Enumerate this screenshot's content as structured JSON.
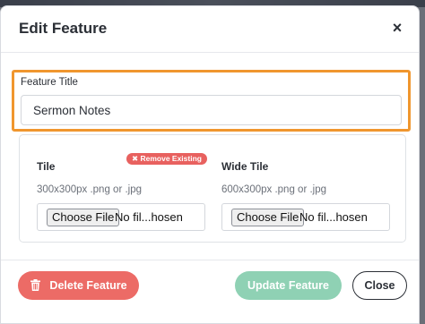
{
  "modal": {
    "title": "Edit Feature",
    "close_icon": "close-icon",
    "close_glyph": "×"
  },
  "feature_title": {
    "label": "Feature Title",
    "value": "Sermon Notes"
  },
  "tile": {
    "label": "Tile",
    "hint": "300x300px .png or .jpg",
    "remove_label": "✖ Remove Existing",
    "choose_label": "Choose File",
    "file_name": "No fil...hosen"
  },
  "wide_tile": {
    "label": "Wide Tile",
    "hint": "600x300px .png or .jpg",
    "choose_label": "Choose File",
    "file_name": "No fil...hosen"
  },
  "footer": {
    "delete_label": "Delete Feature",
    "update_label": "Update Feature",
    "close_label": "Close"
  },
  "colors": {
    "highlight": "#f0962e",
    "danger": "#ec6b66",
    "success_disabled": "#8fd1b4"
  }
}
